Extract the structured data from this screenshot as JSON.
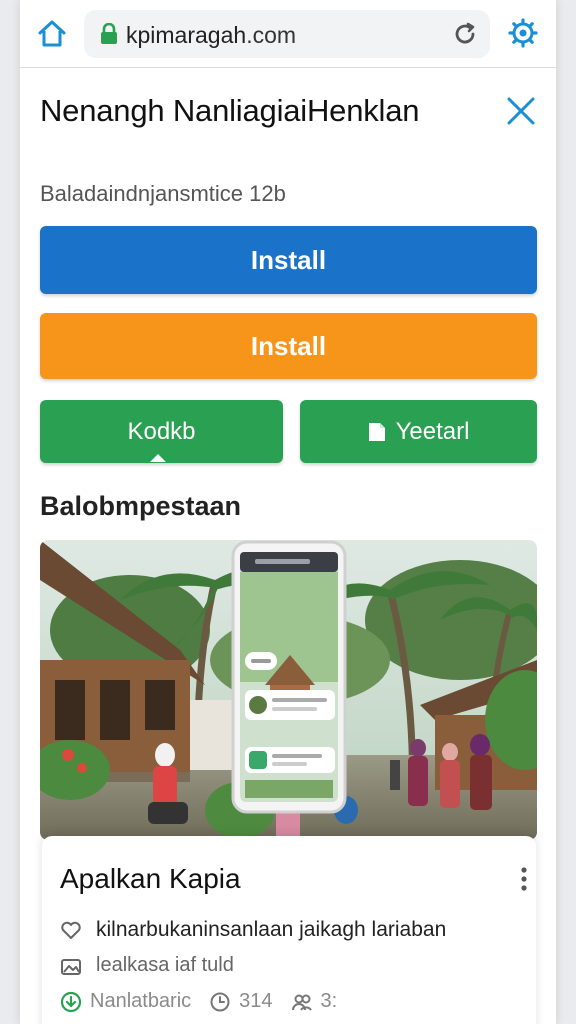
{
  "browser": {
    "url_domain": "kpimaragah",
    "url_tld": ".com"
  },
  "header": {
    "title": "Nenangh NanliagiaiHenklan"
  },
  "subtitle": "Baladaindnjansmtice 12b",
  "buttons": {
    "install_primary": "Install",
    "install_secondary": "Install",
    "left_green": "Kodkb",
    "right_green": "Yeetarl"
  },
  "section": {
    "title": "Balobmpestaan"
  },
  "card": {
    "title": "Apalkan Kapia",
    "row1": "kilnarbukaninsanlaan jaikagh lariaban",
    "row2": "lealkasa iaf tuld",
    "meta_name": "Nanlatbaric",
    "meta_count": "314",
    "meta_extra": "3:"
  },
  "icons": {
    "home": "home-icon",
    "lock": "lock-icon",
    "reload": "reload-icon",
    "settings": "settings-icon",
    "close": "close-icon",
    "document": "document-icon",
    "more": "more-vertical-icon",
    "heart": "heart-icon",
    "image": "image-icon",
    "download": "download-icon",
    "clock": "clock-icon",
    "people": "people-icon"
  },
  "colors": {
    "primary_blue": "#1a73c8",
    "orange": "#f7951a",
    "green": "#2aa052",
    "accent_icon": "#1a8fd6",
    "lock_green": "#2aa052"
  }
}
